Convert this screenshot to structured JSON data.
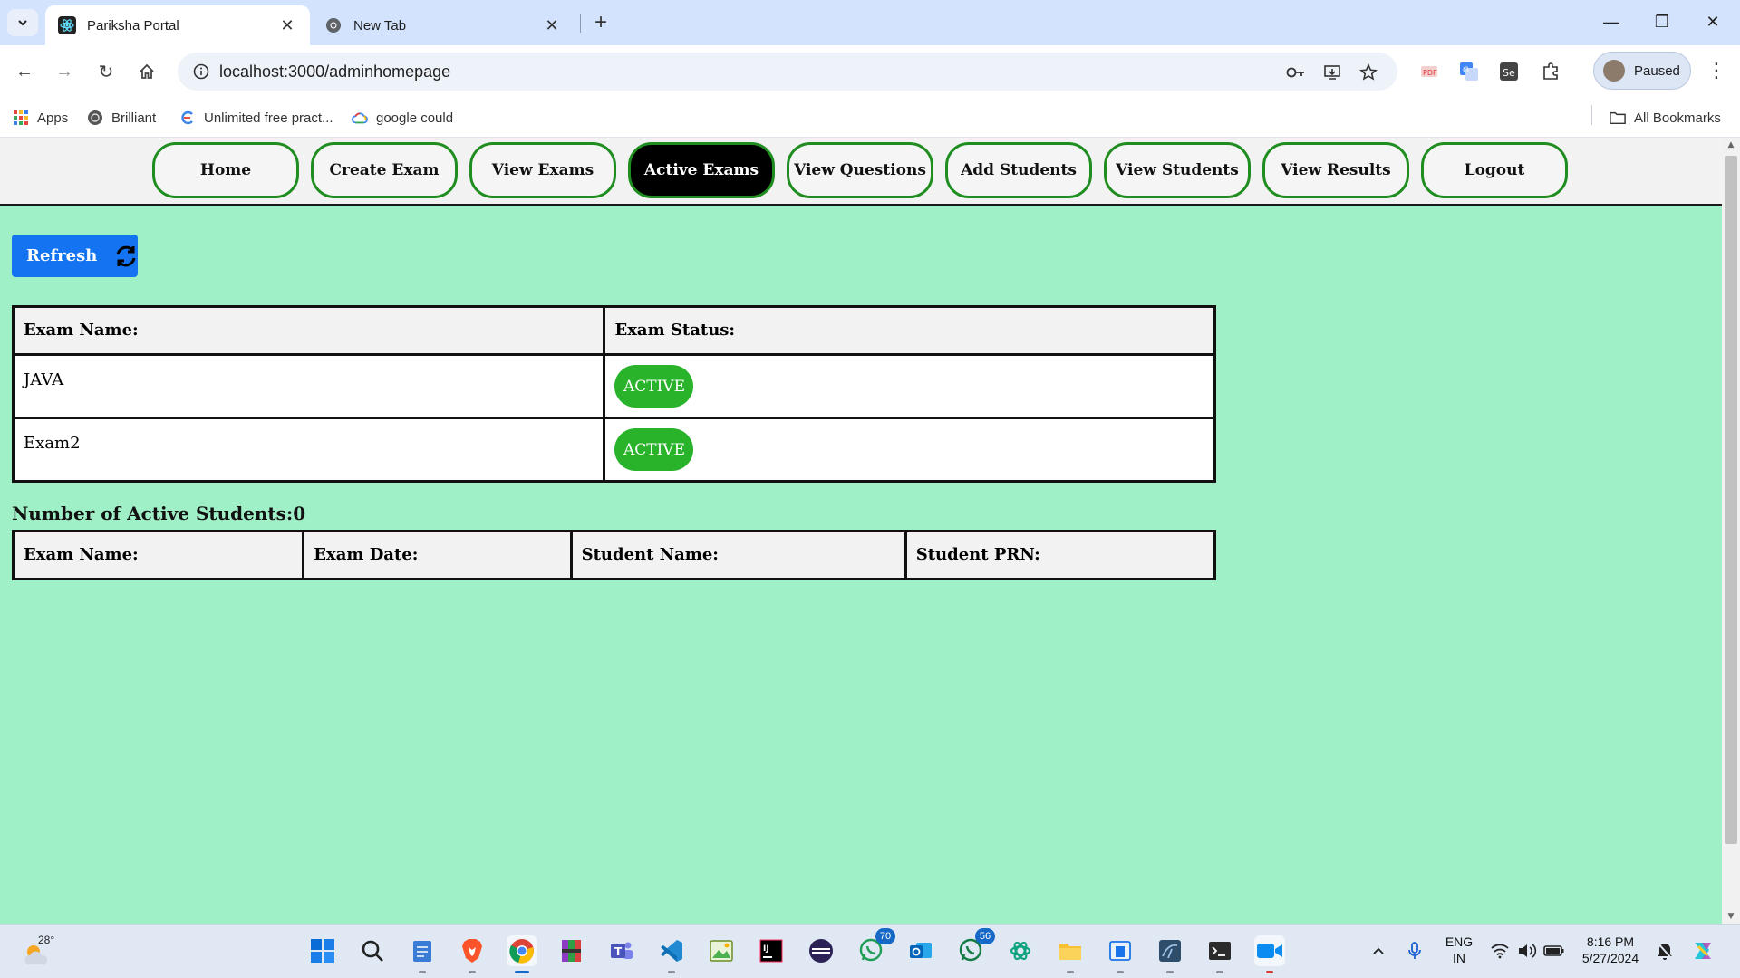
{
  "browser": {
    "tabs": [
      {
        "title": "Pariksha Portal",
        "active": true
      },
      {
        "title": "New Tab",
        "active": false
      }
    ],
    "url": "localhost:3000/adminhomepage",
    "profile_label": "Paused",
    "bookmarks": [
      {
        "label": "Apps",
        "icon": "apps-grid-icon"
      },
      {
        "label": "Brilliant",
        "icon": "brilliant-icon"
      },
      {
        "label": "Unlimited free pract...",
        "icon": "practice-site-icon"
      },
      {
        "label": "google could",
        "icon": "google-cloud-icon"
      }
    ],
    "all_bookmarks_label": "All Bookmarks"
  },
  "nav": {
    "items": [
      "Home",
      "Create Exam",
      "View Exams",
      "Active Exams",
      "View Questions",
      "Add Students",
      "View Students",
      "View Results",
      "Logout"
    ],
    "active": "Active Exams"
  },
  "page": {
    "refresh_label": "Refresh",
    "exams_table": {
      "headers": [
        "Exam Name:",
        "Exam Status:"
      ],
      "rows": [
        {
          "name": "JAVA",
          "status": "ACTIVE"
        },
        {
          "name": "Exam2",
          "status": "ACTIVE"
        }
      ]
    },
    "active_students_label": "Number of Active Students:0",
    "students_table": {
      "headers": [
        "Exam Name:",
        "Exam Date:",
        "Student Name:",
        "Student PRN:"
      ]
    }
  },
  "taskbar": {
    "temperature": "28°",
    "whatsapp_badge": "70",
    "outlook_badge": "56",
    "lang_line1": "ENG",
    "lang_line2": "IN",
    "time": "8:16 PM",
    "date": "5/27/2024"
  },
  "colors": {
    "page_bg": "#9fefc7",
    "nav_border": "#1f8d1f",
    "refresh_bg": "#1473f0",
    "active_badge": "#28b32b"
  }
}
